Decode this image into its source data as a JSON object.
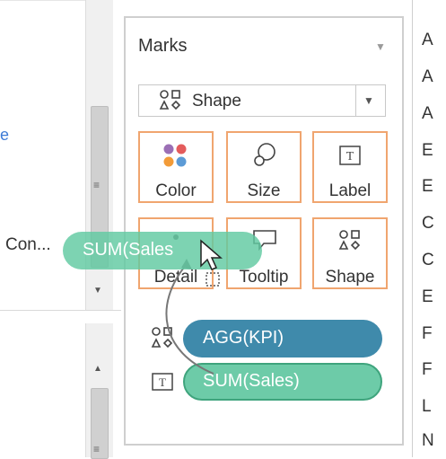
{
  "left_panel": {
    "link_fragment": "e",
    "con_label": "Con..."
  },
  "marks": {
    "title": "Marks",
    "mark_type": "Shape",
    "tiles": [
      {
        "label": "Color",
        "icon": "color-dots-icon"
      },
      {
        "label": "Size",
        "icon": "size-icon"
      },
      {
        "label": "Label",
        "icon": "label-text-icon"
      },
      {
        "label": "Detail",
        "icon": "detail-icon"
      },
      {
        "label": "Tooltip",
        "icon": "tooltip-icon"
      },
      {
        "label": "Shape",
        "icon": "shape-icon"
      }
    ],
    "shelf": [
      {
        "field": "AGG(KPI)",
        "icon": "shape-icon"
      },
      {
        "field": "SUM(Sales)",
        "icon": "label-text-icon"
      }
    ]
  },
  "drag": {
    "pill_text": "SUM(Sales"
  },
  "right_list": {
    "letters": [
      "A",
      "A",
      "A",
      "E",
      "E",
      "C",
      "C",
      "E",
      "F",
      "F",
      "L",
      "N"
    ]
  },
  "colors": {
    "accent_orange": "#f0a56f",
    "pill_blue": "#3f8aab",
    "pill_green": "#6dcba8",
    "pill_green_border": "#3fa47d"
  }
}
